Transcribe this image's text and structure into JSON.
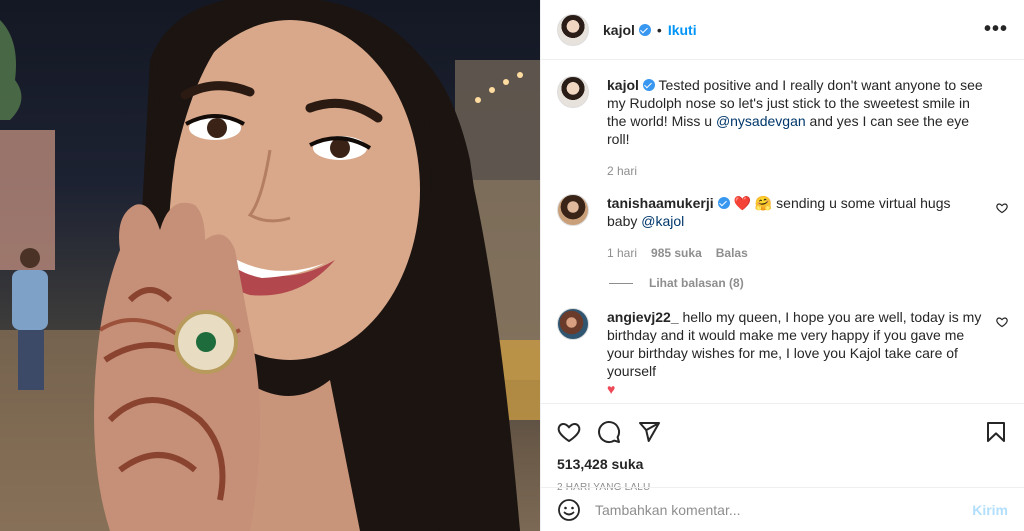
{
  "header": {
    "username": "kajol",
    "separator": "•",
    "follow_label": "Ikuti",
    "more_label": "•••"
  },
  "caption": {
    "username": "kajol",
    "text_before": "Tested positive and I really don't want anyone to see my Rudolph nose so let's just stick to the sweetest smile in the world! Miss u ",
    "mention": "@nysadevgan",
    "text_after": " and yes I can see the eye roll!",
    "time": "2 hari"
  },
  "comments": [
    {
      "username": "tanishaamukerji",
      "emojis": "❤️ 🤗",
      "text": " sending u some virtual hugs baby ",
      "mention": "@kajol",
      "time": "1 hari",
      "likes": "985 suka",
      "reply_label": "Balas",
      "view_replies": "Lihat balasan (8)"
    },
    {
      "username": "angievj22_",
      "text": "hello my queen, I hope you are well, today is my birthday and it would make me very happy if you gave me your birthday wishes for me, I love you Kajol take care of yourself",
      "trailing_emoji": "♥"
    }
  ],
  "actions": {
    "likes_count": "513,428 suka",
    "time_ago": "2 HARI YANG LALU"
  },
  "add_comment": {
    "placeholder": "Tambahkan komentar...",
    "post_label": "Kirim"
  },
  "colors": {
    "accent": "#0095f6",
    "verified": "#3897f0",
    "heart": "#ed4956",
    "muted": "#8e8e8e"
  }
}
